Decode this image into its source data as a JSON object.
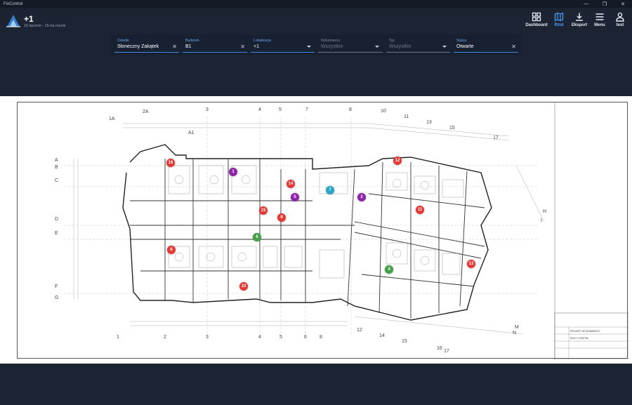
{
  "window": {
    "title": "FixControl",
    "controls": [
      "—",
      "❐",
      "✕"
    ]
  },
  "header": {
    "title": "+1",
    "subtitle": "15 łącznie - 15 na rzucie"
  },
  "nav": [
    {
      "label": "Dashboard",
      "icon": "dashboard-icon",
      "active": false
    },
    {
      "label": "Rzut",
      "icon": "map-icon",
      "active": true
    },
    {
      "label": "Eksport",
      "icon": "download-icon",
      "active": false
    },
    {
      "label": "Menu",
      "icon": "menu-icon",
      "active": false
    },
    {
      "label": "test",
      "icon": "user-icon",
      "active": false
    }
  ],
  "filters": [
    {
      "label": "Osiedle",
      "value": "Słoneczny Zakątek",
      "control": "clear"
    },
    {
      "label": "Budynek",
      "value": "B1",
      "control": "clear"
    },
    {
      "label": "Lokalizacja",
      "value": "+1",
      "control": "dropdown"
    },
    {
      "label": "Wykonawca",
      "value": "Wszystkie",
      "control": "dropdown"
    },
    {
      "label": "Typ",
      "value": "Wszystkie",
      "control": "dropdown"
    },
    {
      "label": "Status",
      "value": "Otwarte",
      "control": "clear"
    }
  ],
  "colors": {
    "red": "#e53935",
    "purple": "#8e24aa",
    "teal": "#26a6c9",
    "green": "#43a047",
    "accent": "#4fa3ff"
  },
  "markers": [
    {
      "n": "1",
      "color": "purple"
    },
    {
      "n": "2",
      "color": "purple"
    },
    {
      "n": "4",
      "color": "green"
    },
    {
      "n": "5",
      "color": "purple"
    },
    {
      "n": "6",
      "color": "green"
    },
    {
      "n": "7",
      "color": "teal"
    },
    {
      "n": "8",
      "color": "red"
    },
    {
      "n": "9",
      "color": "red"
    },
    {
      "n": "10",
      "color": "red"
    },
    {
      "n": "11",
      "color": "red"
    },
    {
      "n": "12",
      "color": "red"
    },
    {
      "n": "13",
      "color": "red"
    },
    {
      "n": "14",
      "color": "red"
    },
    {
      "n": "15",
      "color": "red"
    },
    {
      "n": "16",
      "color": "red"
    }
  ],
  "title_block": {
    "project": "PROJEKT WYKONAWCZY",
    "sheet": "RZUT 1 PIĘTRA"
  },
  "grid_labels_top": [
    "1A",
    "2A",
    "A1",
    "3",
    "4",
    "5",
    "7",
    "8",
    "10",
    "11",
    "13",
    "15",
    "17"
  ],
  "grid_labels_left": [
    "A",
    "B",
    "C",
    "D",
    "E",
    "F",
    "G"
  ],
  "grid_labels_bottom": [
    "1",
    "2",
    "3",
    "4",
    "5",
    "6",
    "8",
    "12",
    "14",
    "15",
    "16",
    "17",
    "M",
    "N"
  ],
  "grid_labels_right": [
    "H",
    "I"
  ]
}
